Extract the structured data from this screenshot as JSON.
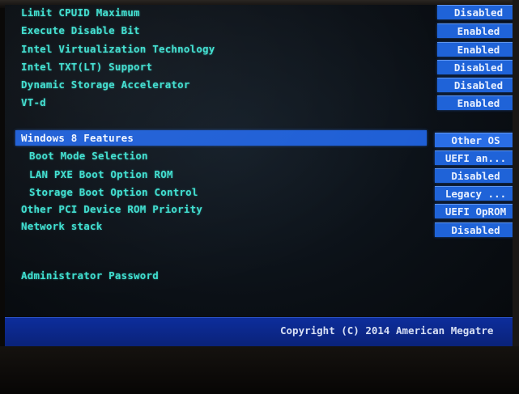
{
  "bios": {
    "top_items": [
      {
        "label": "Limit CPUID Maximum",
        "value": "Disabled"
      },
      {
        "label": "Execute Disable Bit",
        "value": "Enabled"
      },
      {
        "label": "Intel Virtualization Technology",
        "value": "Enabled"
      },
      {
        "label": "Intel TXT(LT) Support",
        "value": "Disabled"
      },
      {
        "label": "Dynamic Storage Accelerator",
        "value": "Disabled"
      },
      {
        "label": "VT-d",
        "value": "Enabled"
      }
    ],
    "windows_section": {
      "label": "Windows 8 Features",
      "value": "Other OS"
    },
    "sub_items": [
      {
        "label": "Boot Mode Selection",
        "value": "UEFI an..."
      },
      {
        "label": "LAN PXE Boot Option ROM",
        "value": "Disabled"
      },
      {
        "label": "Storage Boot Option Control",
        "value": "Legacy ..."
      }
    ],
    "other_items": [
      {
        "label": "Other PCI Device ROM Priority",
        "value": "UEFI OpROM"
      },
      {
        "label": "Network stack",
        "value": "Disabled"
      }
    ],
    "admin_password_label": "Administrator Password"
  },
  "footer": {
    "copyright": "Copyright (C) 2014 American Megatre"
  },
  "colors": {
    "label_cyan": "#3fdfd0",
    "value_blue": "#1f63d8",
    "highlight_blue": "#1f5fd6",
    "footer_blue": "#0d2d9c"
  }
}
